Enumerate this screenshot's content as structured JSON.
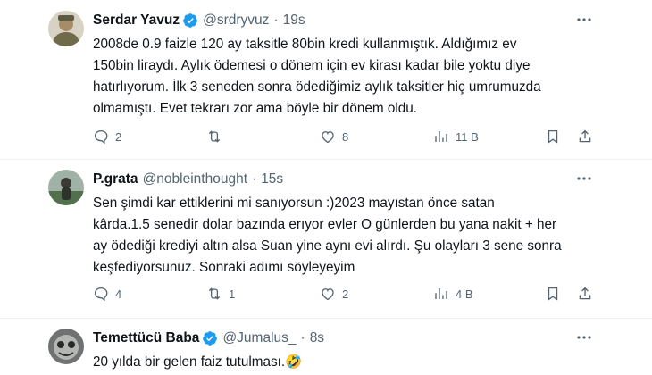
{
  "tweets": [
    {
      "name": "Serdar Yavuz",
      "handle": "@srdryvuz",
      "time": "19s",
      "text": "2008de 0.9 faizle 120 ay taksitle 80bin kredi kullanmıştık. Aldığımız ev\n150bin liraydı. Aylık ödemesi o dönem için ev kirası kadar bile yoktu diye\nhatırlıyorum. İlk 3 seneden sonra ödediğimiz aylık taksitler hiç umrumuzda\nolmamıştı. Evet tekrarı zor ama böyle bir dönem oldu.",
      "replies": "2",
      "retweets": "",
      "likes": "8",
      "views": "11 B"
    },
    {
      "name": "P.grata",
      "handle": "@nobleinthought",
      "time": "15s",
      "text": "Sen şimdi kar ettiklerini mi sanıyorsun :)2023 mayıstan önce satan\nkârda.1.5 senedir dolar bazında erıyor evler O günlerden bu yana nakit + her\nay ödediği krediyi altın alsa Suan yine aynı evi alırdı. Şu olayları 3 sene sonra\nkeşfediyorsunuz. Sonraki adımı söyleyeyim",
      "replies": "4",
      "retweets": "1",
      "likes": "2",
      "views": "4 B"
    },
    {
      "name": "Temettücü Baba",
      "handle": "@Jumalus_",
      "time": "8s",
      "text": "20 yılda bir gelen faiz tutulması.🤣"
    }
  ],
  "colors": {
    "verified": "#1d9bf0",
    "secondary": "#536471",
    "text": "#0f1419"
  },
  "icons": [
    "more-icon",
    "reply-icon",
    "retweet-icon",
    "like-icon",
    "views-icon",
    "bookmark-icon",
    "share-icon",
    "verified-icon"
  ]
}
